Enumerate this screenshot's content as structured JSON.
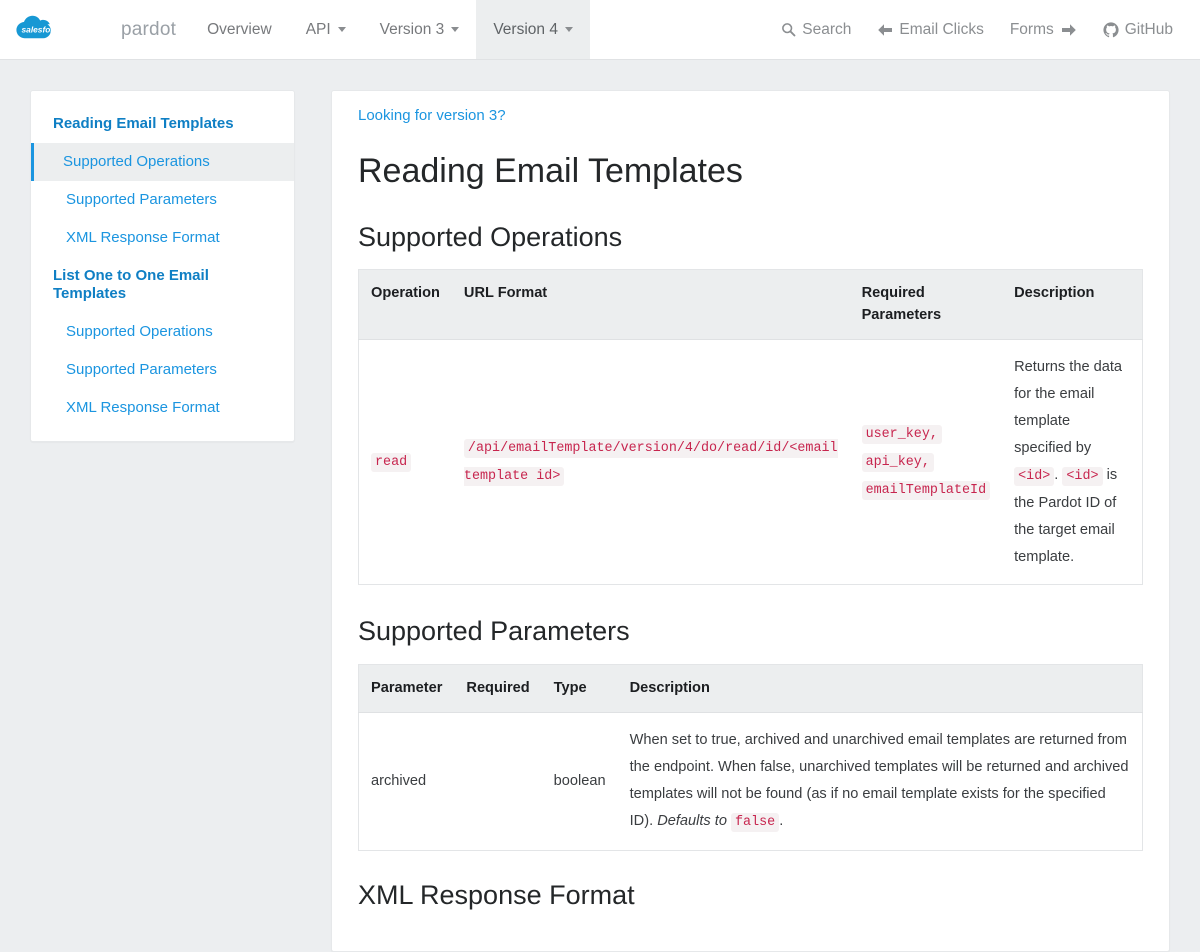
{
  "brand": {
    "cloud_text": "salesforce",
    "word": "pardot",
    "cloud_color": "#1798d4"
  },
  "navbar": {
    "left_items": [
      {
        "label": "Overview",
        "caret": false,
        "active": false
      },
      {
        "label": "API",
        "caret": true,
        "active": false
      },
      {
        "label": "Version 3",
        "caret": true,
        "active": false
      },
      {
        "label": "Version 4",
        "caret": true,
        "active": true
      }
    ],
    "right_items": [
      {
        "label": "Search",
        "icon": "search-icon",
        "icon_pos": "pre"
      },
      {
        "label": "Email Clicks",
        "icon": "arrow-left-icon",
        "icon_pos": "pre"
      },
      {
        "label": "Forms",
        "icon": "arrow-right-icon",
        "icon_pos": "post"
      },
      {
        "label": "GitHub",
        "icon": "github-icon",
        "icon_pos": "pre"
      }
    ]
  },
  "sidebar": {
    "groups": [
      {
        "title": "Reading Email Templates",
        "links": [
          {
            "label": "Supported Operations",
            "active": true
          },
          {
            "label": "Supported Parameters",
            "active": false
          },
          {
            "label": "XML Response Format",
            "active": false
          }
        ]
      },
      {
        "title": "List One to One Email Templates",
        "links": [
          {
            "label": "Supported Operations",
            "active": false
          },
          {
            "label": "Supported Parameters",
            "active": false
          },
          {
            "label": "XML Response Format",
            "active": false
          }
        ]
      }
    ]
  },
  "content": {
    "version_link": "Looking for version 3?",
    "title": "Reading Email Templates",
    "section_operations": "Supported Operations",
    "section_parameters": "Supported Parameters",
    "section_xml": "XML Response Format",
    "operations_table": {
      "headers": [
        "Operation",
        "URL Format",
        "Required Parameters",
        "Description"
      ],
      "rows": [
        {
          "operation": "read",
          "url_format": "/api/emailTemplate/version/4/do/read/id/<email template id>",
          "required_parameters": [
            "user_key,",
            "api_key,",
            "emailTemplateId"
          ],
          "description_part1": "Returns the data for the email template specified by ",
          "description_code1": "<id>",
          "description_part2": ". ",
          "description_code2": "<id>",
          "description_part3": " is the Pardot ID of the target email template."
        }
      ]
    },
    "parameters_table": {
      "headers": [
        "Parameter",
        "Required",
        "Type",
        "Description"
      ],
      "rows": [
        {
          "parameter": "archived",
          "required": "",
          "type": "boolean",
          "description_main": "When set to true, archived and unarchived email templates are returned from the endpoint. When false, unarchived templates will be returned and archived templates will not be found (as if no email template exists for the specified ID). ",
          "description_em": "Defaults to",
          "description_code": "false",
          "description_end": "."
        }
      ]
    }
  },
  "colors": {
    "brand_blue": "#1798d4",
    "link_blue": "#1b95e0",
    "code_crimson": "#c7254e",
    "page_bg": "#eceef0",
    "header_bg": "#eceeef"
  }
}
